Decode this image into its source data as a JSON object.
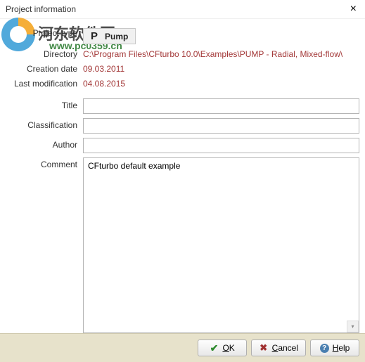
{
  "window": {
    "title": "Project information"
  },
  "watermark": {
    "line1": "河东软件园",
    "line2": "www.pc0359.cn"
  },
  "labels": {
    "project_type": "Project type",
    "directory": "Directory",
    "creation_date": "Creation date",
    "last_modification": "Last modification",
    "title": "Title",
    "classification": "Classification",
    "author": "Author",
    "comment": "Comment"
  },
  "values": {
    "project_type_code": "P",
    "project_type_name": "Pump",
    "directory": "C:\\Program Files\\CFturbo 10.0\\Examples\\PUMP - Radial, Mixed-flow\\",
    "creation_date": "09.03.2011",
    "last_modification": "04.08.2015",
    "title": "",
    "classification": "",
    "author": "",
    "comment": "CFturbo default example"
  },
  "buttons": {
    "ok": "OK",
    "cancel": "Cancel",
    "help": "Help"
  }
}
